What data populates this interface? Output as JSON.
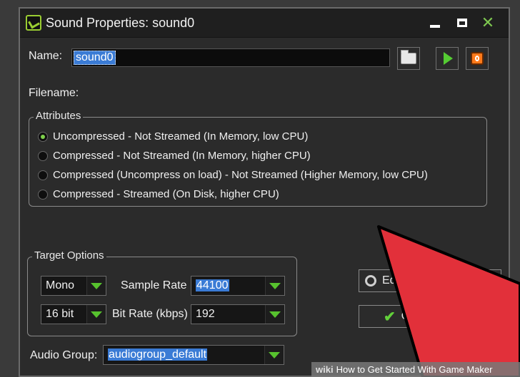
{
  "window": {
    "title": "Sound Properties: sound0"
  },
  "name_field": {
    "label": "Name:",
    "value": "sound0"
  },
  "filename": {
    "label": "Filename:"
  },
  "attributes": {
    "legend": "Attributes",
    "options": [
      {
        "label": "Uncompressed - Not Streamed (In Memory, low CPU)",
        "selected": true
      },
      {
        "label": "Compressed - Not Streamed (In Memory, higher CPU)",
        "selected": false
      },
      {
        "label": "Compressed (Uncompress on load) - Not Streamed (Higher Memory, low CPU)",
        "selected": false
      },
      {
        "label": "Compressed - Streamed (On Disk, higher CPU)",
        "selected": false
      }
    ]
  },
  "target_options": {
    "legend": "Target Options",
    "channels": "Mono",
    "bit_depth": "16 bit",
    "sample_rate_label": "Sample Rate",
    "sample_rate": "44100",
    "bit_rate_label": "Bit Rate (kbps)",
    "bit_rate": "192"
  },
  "audio_group": {
    "label": "Audio Group:",
    "value": "audiogroup_default"
  },
  "buttons": {
    "edit_partial": "Ed",
    "ok_partial": "O"
  },
  "watermark": {
    "brand": "wiki",
    "text": "How to Get Started With Game Maker"
  },
  "colors": {
    "accent_green": "#57c22e",
    "selection_blue": "#3a7bd5",
    "arrow_red": "#e2303a",
    "stop_orange": "#ff7a1a"
  }
}
